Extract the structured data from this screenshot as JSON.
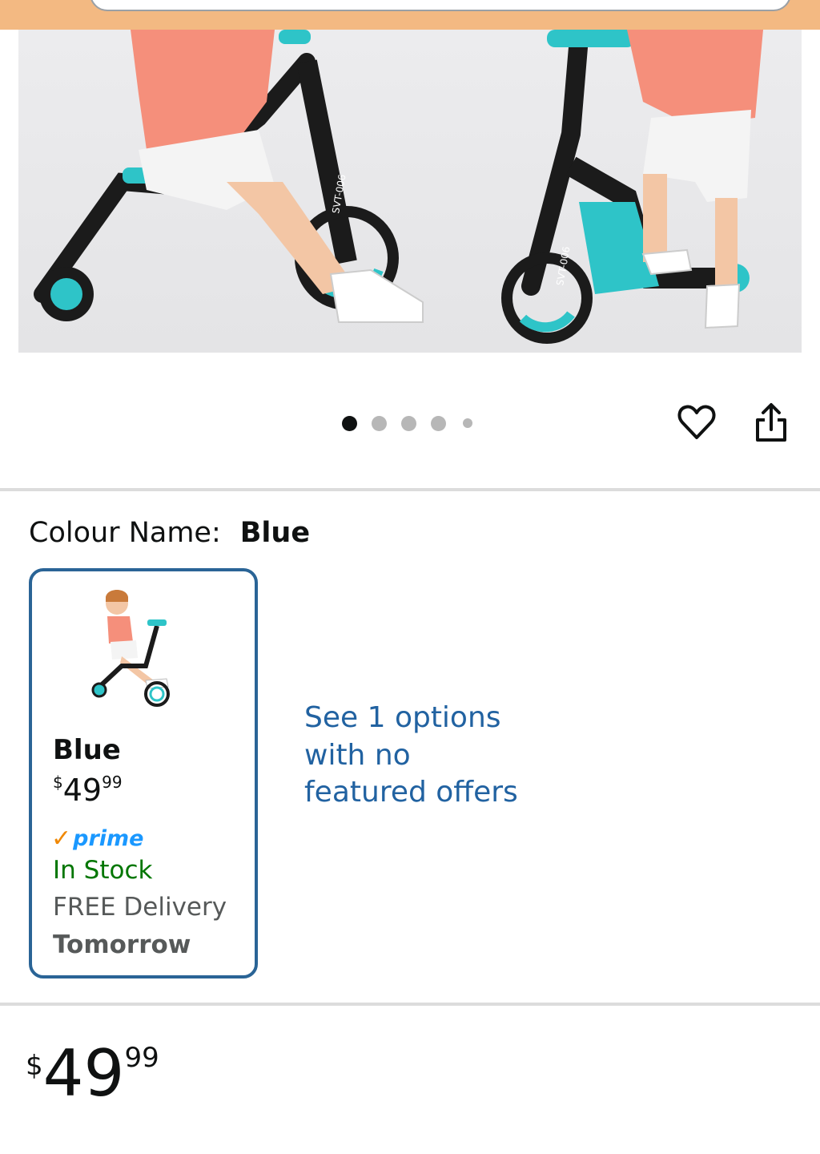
{
  "gallery": {
    "image_count": 5,
    "active_index": 0,
    "product_image_text": "SVT-006"
  },
  "variation": {
    "label": "Colour Name:",
    "selected_value": "Blue"
  },
  "swatch": {
    "name": "Blue",
    "price_symbol": "$",
    "price_whole": "49",
    "price_fraction": "99",
    "prime_label": "prime",
    "stock": "In Stock",
    "delivery_label": "FREE Delivery",
    "delivery_date": "Tomorrow"
  },
  "options_link": "See 1 options with no featured offers",
  "price": {
    "symbol": "$",
    "whole": "49",
    "fraction": "99"
  },
  "colors": {
    "topbar": "#f3b982",
    "swatch_border": "#2a6496",
    "link": "#2162a1",
    "in_stock": "#007600",
    "prime_check": "#f08804",
    "prime_word": "#1a98ff",
    "scooter_accent": "#2ec4c8"
  },
  "icons": [
    "heart-icon",
    "share-icon",
    "prime-check-icon"
  ]
}
